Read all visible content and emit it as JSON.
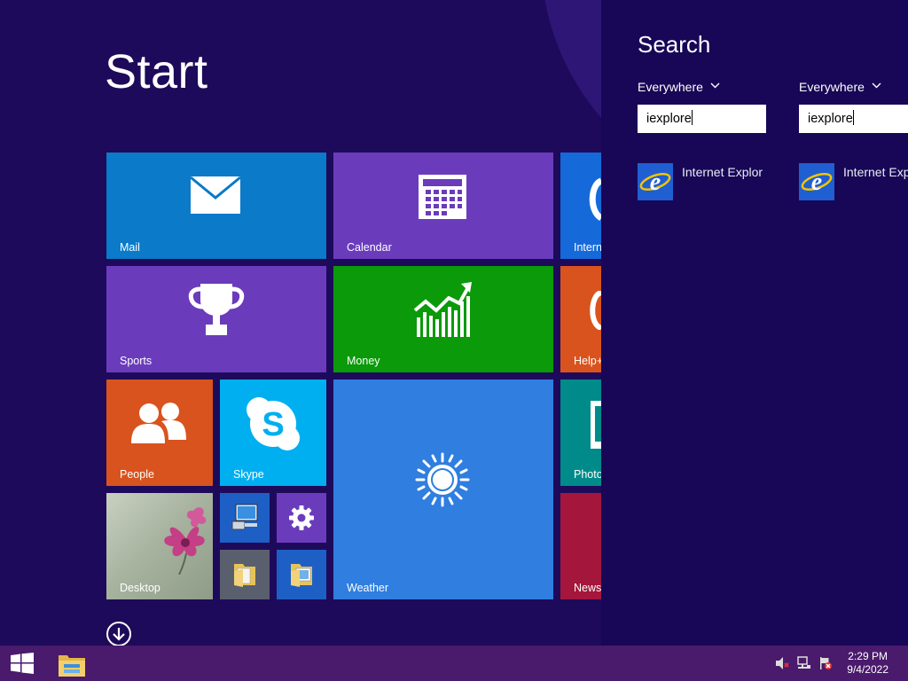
{
  "start": {
    "title": "Start"
  },
  "tiles": {
    "mail": "Mail",
    "calendar": "Calendar",
    "internet_explorer": "Intern",
    "sports": "Sports",
    "money": "Money",
    "help": "Help+",
    "people": "People",
    "skype": "Skype",
    "weather": "Weather",
    "photos": "Photo",
    "desktop": "Desktop",
    "news": "News"
  },
  "search": {
    "title": "Search",
    "panels": [
      {
        "scope": "Everywhere",
        "query": "iexplore",
        "result": "Internet Explor"
      },
      {
        "scope": "Everywhere",
        "query": "iexplore",
        "result": "Internet Exp"
      }
    ]
  },
  "taskbar": {
    "time": "2:29 PM",
    "date": "9/4/2022"
  },
  "colors": {
    "background": "#1e0a5a",
    "search_pane": "#170756",
    "taskbar": "#4a1a6c",
    "mail_tile": "#0a7ac9",
    "calendar_tile": "#6a3cbc",
    "sports_tile": "#6a3cbc",
    "money_tile": "#0a9a0a",
    "people_tile": "#d9531e",
    "skype_tile": "#00aff0",
    "weather_tile": "#2f7ee0",
    "help_tile": "#d9531e",
    "photos_tile": "#008a8a",
    "news_tile": "#a4163b"
  },
  "icons": [
    "mail-icon",
    "calendar-icon",
    "internet-explorer-icon",
    "trophy-icon",
    "chart-icon",
    "people-icon",
    "skype-icon",
    "sun-icon",
    "computer-icon",
    "gear-icon",
    "folder-icon",
    "arrow-down-icon",
    "windows-logo-icon",
    "volume-muted-icon",
    "network-icon",
    "action-center-flag-icon"
  ]
}
